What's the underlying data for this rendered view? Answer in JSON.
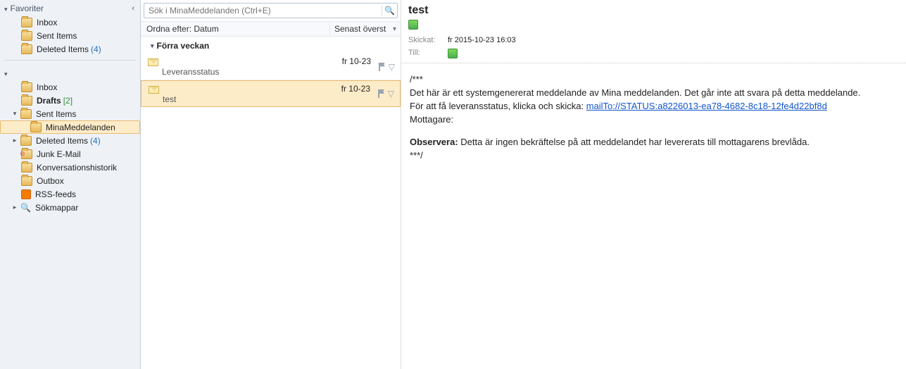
{
  "sidebar": {
    "favorites_label": "Favoriter",
    "favorites": [
      {
        "label": "Inbox",
        "count": "",
        "count_class": ""
      },
      {
        "label": "Sent Items",
        "count": "",
        "count_class": ""
      },
      {
        "label": "Deleted Items",
        "count": "(4)",
        "count_class": "count-blue"
      }
    ],
    "account_tree": [
      {
        "label": "Inbox",
        "indent": "lvl0",
        "toggle": "",
        "count": "",
        "cclass": "",
        "bold": false,
        "selected": false,
        "iconvariant": "folder"
      },
      {
        "label": "Drafts",
        "indent": "lvl0",
        "toggle": "",
        "count": "[2]",
        "cclass": "count-green",
        "bold": true,
        "selected": false,
        "iconvariant": "folder"
      },
      {
        "label": "Sent Items",
        "indent": "hastoggle",
        "toggle": "▾",
        "count": "",
        "cclass": "",
        "bold": false,
        "selected": false,
        "iconvariant": "folder"
      },
      {
        "label": "MinaMeddelanden",
        "indent": "lvl1",
        "toggle": "",
        "count": "",
        "cclass": "",
        "bold": false,
        "selected": true,
        "iconvariant": "folder"
      },
      {
        "label": "Deleted Items",
        "indent": "hastoggle",
        "toggle": "▸",
        "count": "(4)",
        "cclass": "count-blue",
        "bold": false,
        "selected": false,
        "iconvariant": "folder"
      },
      {
        "label": "Junk E-Mail",
        "indent": "lvl0",
        "toggle": "",
        "count": "",
        "cclass": "",
        "bold": false,
        "selected": false,
        "iconvariant": "junk"
      },
      {
        "label": "Konversationshistorik",
        "indent": "lvl0",
        "toggle": "",
        "count": "",
        "cclass": "",
        "bold": false,
        "selected": false,
        "iconvariant": "folder"
      },
      {
        "label": "Outbox",
        "indent": "lvl0",
        "toggle": "",
        "count": "",
        "cclass": "",
        "bold": false,
        "selected": false,
        "iconvariant": "folder"
      },
      {
        "label": "RSS-feeds",
        "indent": "lvl0",
        "toggle": "",
        "count": "",
        "cclass": "",
        "bold": false,
        "selected": false,
        "iconvariant": "rss"
      },
      {
        "label": "Sökmappar",
        "indent": "hastoggle",
        "toggle": "▸",
        "count": "",
        "cclass": "",
        "bold": false,
        "selected": false,
        "iconvariant": "search"
      }
    ]
  },
  "list": {
    "search_placeholder": "Sök i MinaMeddelanden (Ctrl+E)",
    "sort_label": "Ordna efter: Datum",
    "sort_order": "Senast överst",
    "group_header": "Förra veckan",
    "messages": [
      {
        "subject": "Leveransstatus",
        "date": "fr 10-23",
        "selected": false
      },
      {
        "subject": "test",
        "date": "fr 10-23",
        "selected": true
      }
    ]
  },
  "reader": {
    "subject": "test",
    "sent_label": "Skickat:",
    "sent_value": "fr 2015-10-23 16:03",
    "to_label": "Till:",
    "body_open": "/***",
    "body_line1": "Det här är ett systemgenererat meddelande av Mina meddelanden. Det går inte att svara på detta meddelande.",
    "body_line2_pre": "För att få leveransstatus, klicka och skicka: ",
    "body_link": "mailTo://STATUS:a8226013-ea78-4682-8c18-12fe4d22bf8d",
    "body_line3": "Mottagare:",
    "body_obs_label": "Observera:",
    "body_obs_text": " Detta är ingen bekräftelse på att meddelandet har levererats till mottagarens brevlåda.",
    "body_close": "***/"
  }
}
